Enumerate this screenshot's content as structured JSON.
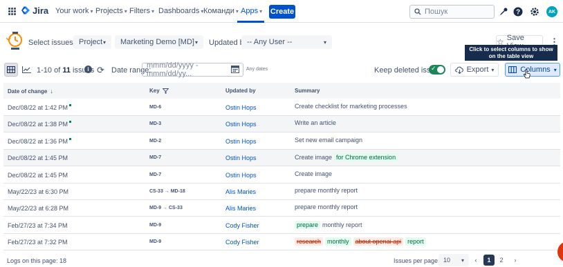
{
  "topnav": {
    "brand": "Jira",
    "items": [
      {
        "label": "Your work"
      },
      {
        "label": "Projects"
      },
      {
        "label": "Filters"
      },
      {
        "label": "Dashboards"
      },
      {
        "label": "Команди"
      },
      {
        "label": "Apps"
      }
    ],
    "active_item": "Apps",
    "create_label": "Create",
    "search_placeholder": "Пошук",
    "avatar_initials": "AK",
    "accent_color": "#0052cc"
  },
  "filters": {
    "select_issues_label": "Select issues by:",
    "select_by_value": "Project",
    "project_value": "Marketing Demo [MD]",
    "updated_by_label": "Updated by:",
    "updated_by_value": "-- Any User --",
    "save_view_label": "Save View",
    "tooltip": "Click to select columns to show on the table view"
  },
  "toolbar": {
    "range": "1-10",
    "of": "of",
    "total": "11",
    "issues": "issues",
    "date_range_label": "Date range:",
    "date_placeholder": "mmm/dd/yyyy - mmm/dd/yy...",
    "any_dates": "Any dates",
    "keep_deleted_label": "Keep deleted issues",
    "keep_deleted_on": true,
    "export_label": "Export",
    "columns_label": "Columns"
  },
  "table": {
    "columns": [
      "Date of change",
      "Key",
      "Updated by",
      "Summary"
    ],
    "rows": [
      {
        "date": "Dec/08/22 at 1:42 PM",
        "dot": true,
        "key": "MD-6",
        "user": "Ostin Hops",
        "summary": [
          {
            "text": "Create checklist for marketing processes",
            "style": "plain"
          }
        ],
        "highlight": false
      },
      {
        "date": "Dec/08/22 at 1:38 PM",
        "dot": true,
        "key": "MD-3",
        "user": "Ostin Hops",
        "summary": [
          {
            "text": "Write an article",
            "style": "plain"
          }
        ],
        "highlight": true
      },
      {
        "date": "Dec/08/22 at 1:36 PM",
        "dot": true,
        "key": "MD-2",
        "user": "Ostin Hops",
        "summary": [
          {
            "text": "Set new email campaign",
            "style": "plain"
          }
        ],
        "highlight": false
      },
      {
        "date": "Dec/08/22 at 1:45 PM",
        "dot": false,
        "key": "MD-7",
        "user": "Ostin Hops",
        "summary": [
          {
            "text": "Create image",
            "style": "plain"
          },
          {
            "text": "for Chrome extension",
            "style": "add"
          }
        ],
        "highlight": true
      },
      {
        "date": "Dec/08/22 at 1:45 PM",
        "dot": false,
        "key": "MD-7",
        "user": "Ostin Hops",
        "summary": [
          {
            "text": "Create image",
            "style": "plain"
          }
        ],
        "highlight": false
      },
      {
        "date": "May/22/23 at 6:30 PM",
        "dot": false,
        "key": "CS-33 → MD-18",
        "user": "Alis Maries",
        "summary": [
          {
            "text": "prepare monthly report",
            "style": "plain"
          }
        ],
        "highlight": false
      },
      {
        "date": "May/22/23 at 6:28 PM",
        "dot": false,
        "key": "MD-9 → CS-33",
        "user": "Alis Maries",
        "summary": [
          {
            "text": "prepare monthly report",
            "style": "plain"
          }
        ],
        "highlight": false
      },
      {
        "date": "Feb/27/23 at 7:34 PM",
        "dot": false,
        "key": "MD-9",
        "user": "Cody Fisher",
        "summary": [
          {
            "text": "prepare",
            "style": "add"
          },
          {
            "text": "monthly report",
            "style": "plain"
          }
        ],
        "highlight": false
      },
      {
        "date": "Feb/27/23 at 7:32 PM",
        "dot": false,
        "key": "MD-9",
        "user": "Cody Fisher",
        "summary": [
          {
            "text": "research",
            "style": "del"
          },
          {
            "text": "monthly",
            "style": "add"
          },
          {
            "text": "about openai api",
            "style": "del"
          },
          {
            "text": "report",
            "style": "add"
          }
        ],
        "highlight": false
      }
    ]
  },
  "footer": {
    "logs_label": "Logs on this page: 18",
    "ipp_label": "Issues per page:",
    "ipp_value": "10",
    "pages": [
      "1",
      "2"
    ],
    "current_page": "1"
  },
  "colors": {
    "add_bg": "#e3fcef",
    "del_bg": "#ffebe6",
    "toggle_on": "#1f845a"
  }
}
